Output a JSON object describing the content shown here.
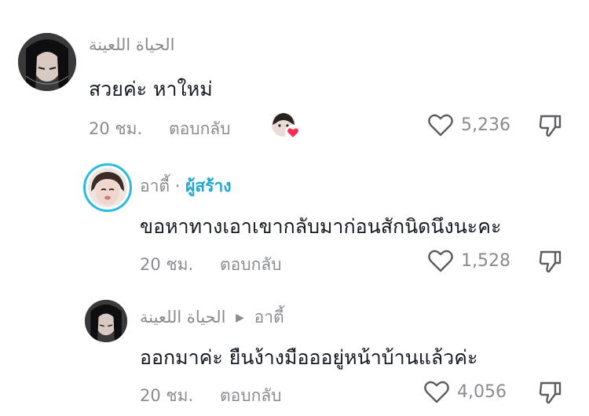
{
  "comments": [
    {
      "username": "الحياة اللعينة",
      "text": "สวยค่ะ หาใหม่",
      "time": "20 ชม.",
      "reply_label": "ตอบกลับ",
      "likes": "5,236",
      "liked_by_creator": true
    },
    {
      "username": "อาตี้",
      "separator": "·",
      "creator_badge": "ผู้สร้าง",
      "text": "ขอหาทางเอาเขากลับมาก่อนสักนิดนึงนะคะ",
      "time": "20 ชม.",
      "reply_label": "ตอบกลับ",
      "likes": "1,528"
    },
    {
      "username": "الحياة اللعينة",
      "reply_to": "อาตี้",
      "text": "ออกมาค่ะ ยืนง้างมือออยู่หน้าบ้านแล้วค่ะ",
      "time": "20 ชม.",
      "reply_label": "ตอบกลับ",
      "likes": "4,056"
    }
  ],
  "colors": {
    "text": "#161823",
    "muted": "#8a8b91",
    "creator": "#20a6d2",
    "heart_badge": "#fe2c55"
  },
  "icons": {
    "like": "heart-outline-icon",
    "dislike": "thumbs-down-outline-icon",
    "reply_arrow": "triangle-right-icon",
    "creator_liked": "heart-badge-icon"
  }
}
